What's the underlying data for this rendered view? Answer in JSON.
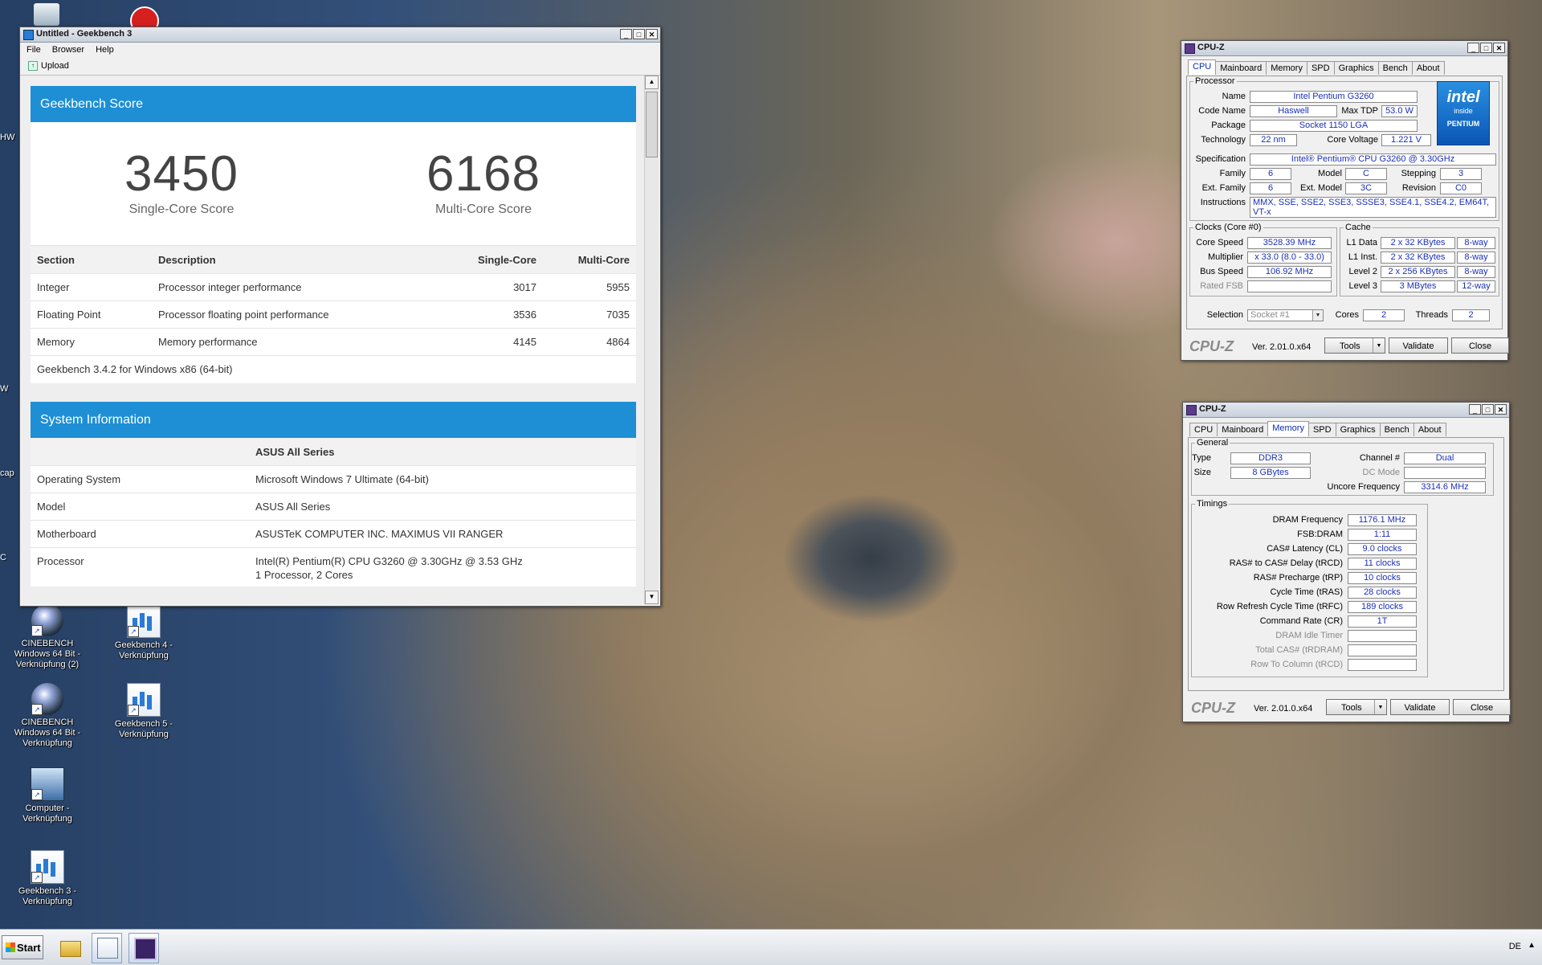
{
  "desktop": {
    "icons": [
      {
        "name": "cinebench-1",
        "label": "CINEBENCH Windows 64 Bit - Verknüpfung (2)",
        "type": "cine"
      },
      {
        "name": "geekbench4",
        "label": "Geekbench 4 - Verknüpfung",
        "type": "gb"
      },
      {
        "name": "cinebench-2",
        "label": "CINEBENCH Windows 64 Bit - Verknüpfung",
        "type": "cine"
      },
      {
        "name": "geekbench5",
        "label": "Geekbench 5 - Verknüpfung",
        "type": "gb"
      },
      {
        "name": "computer",
        "label": "Computer - Verknüpfung",
        "type": "comp"
      },
      {
        "name": "geekbench3",
        "label": "Geekbench 3 - Verknüpfung",
        "type": "gb"
      }
    ],
    "side_labels": [
      "HW",
      "W",
      "cap",
      "C"
    ]
  },
  "geekbench": {
    "title": "Untitled - Geekbench 3",
    "menu": [
      "File",
      "Browser",
      "Help"
    ],
    "toolbar_upload": "Upload",
    "score_header": "Geekbench Score",
    "single_score": "3450",
    "single_label": "Single-Core Score",
    "multi_score": "6168",
    "multi_label": "Multi-Core Score",
    "columns": [
      "Section",
      "Description",
      "Single-Core",
      "Multi-Core"
    ],
    "rows": [
      {
        "section": "Integer",
        "desc": "Processor integer performance",
        "single": "3017",
        "multi": "5955"
      },
      {
        "section": "Floating Point",
        "desc": "Processor floating point performance",
        "single": "3536",
        "multi": "7035"
      },
      {
        "section": "Memory",
        "desc": "Memory performance",
        "single": "4145",
        "multi": "4864"
      }
    ],
    "version": "Geekbench 3.4.2 for Windows x86 (64-bit)",
    "sys_header": "System Information",
    "sys_title": "ASUS All Series",
    "sys_rows": [
      {
        "k": "Operating System",
        "v": "Microsoft Windows 7 Ultimate (64-bit)"
      },
      {
        "k": "Model",
        "v": "ASUS All Series"
      },
      {
        "k": "Motherboard",
        "v": "ASUSTeK COMPUTER INC. MAXIMUS VII RANGER"
      },
      {
        "k": "Processor",
        "v": "Intel(R) Pentium(R) CPU G3260 @ 3.30GHz @ 3.53 GHz",
        "v2": "1 Processor, 2 Cores"
      }
    ]
  },
  "cpuz_cpu": {
    "title": "CPU-Z",
    "tabs": [
      "CPU",
      "Mainboard",
      "Memory",
      "SPD",
      "Graphics",
      "Bench",
      "About"
    ],
    "active_tab": "CPU",
    "processor_legend": "Processor",
    "name_label": "Name",
    "name": "Intel Pentium G3260",
    "codename_label": "Code Name",
    "codename": "Haswell",
    "maxtdp_label": "Max TDP",
    "maxtdp": "53.0 W",
    "package_label": "Package",
    "package": "Socket 1150 LGA",
    "tech_label": "Technology",
    "tech": "22 nm",
    "voltage_label": "Core Voltage",
    "voltage": "1.221 V",
    "spec_label": "Specification",
    "spec": "Intel® Pentium® CPU G3260 @ 3.30GHz",
    "family_label": "Family",
    "family": "6",
    "model_label": "Model",
    "model": "C",
    "stepping_label": "Stepping",
    "stepping": "3",
    "extfamily_label": "Ext. Family",
    "extfamily": "6",
    "extmodel_label": "Ext. Model",
    "extmodel": "3C",
    "revision_label": "Revision",
    "revision": "C0",
    "instr_label": "Instructions",
    "instr": "MMX, SSE, SSE2, SSE3, SSSE3, SSE4.1, SSE4.2, EM64T, VT-x",
    "intel_logo": {
      "w1": "intel",
      "w2": "inside",
      "w3": "PENTIUM"
    },
    "clocks_legend": "Clocks (Core #0)",
    "corespeed_label": "Core Speed",
    "corespeed": "3528.39 MHz",
    "multiplier_label": "Multiplier",
    "multiplier": "x 33.0 (8.0 - 33.0)",
    "busspeed_label": "Bus Speed",
    "busspeed": "106.92 MHz",
    "ratedfsb_label": "Rated FSB",
    "ratedfsb": "",
    "cache_legend": "Cache",
    "cache": [
      {
        "label": "L1 Data",
        "size": "2 x 32 KBytes",
        "way": "8-way"
      },
      {
        "label": "L1 Inst.",
        "size": "2 x 32 KBytes",
        "way": "8-way"
      },
      {
        "label": "Level 2",
        "size": "2 x 256 KBytes",
        "way": "8-way"
      },
      {
        "label": "Level 3",
        "size": "3 MBytes",
        "way": "12-way"
      }
    ],
    "selection_label": "Selection",
    "selection": "Socket #1",
    "cores_label": "Cores",
    "cores": "2",
    "threads_label": "Threads",
    "threads": "2",
    "logo": "CPU-Z",
    "version": "Ver. 2.01.0.x64",
    "tools": "Tools",
    "validate": "Validate",
    "close": "Close"
  },
  "cpuz_mem": {
    "title": "CPU-Z",
    "tabs": [
      "CPU",
      "Mainboard",
      "Memory",
      "SPD",
      "Graphics",
      "Bench",
      "About"
    ],
    "active_tab": "Memory",
    "general_legend": "General",
    "type_label": "Type",
    "type": "DDR3",
    "size_label": "Size",
    "size": "8 GBytes",
    "channel_label": "Channel #",
    "channel": "Dual",
    "dcmode_label": "DC Mode",
    "dcmode": "",
    "uncore_label": "Uncore Frequency",
    "uncore": "3314.6 MHz",
    "timings_legend": "Timings",
    "timings": [
      {
        "label": "DRAM Frequency",
        "value": "1176.1 MHz",
        "dim": false
      },
      {
        "label": "FSB:DRAM",
        "value": "1:11",
        "dim": false
      },
      {
        "label": "CAS# Latency (CL)",
        "value": "9.0 clocks",
        "dim": false
      },
      {
        "label": "RAS# to CAS# Delay (tRCD)",
        "value": "11 clocks",
        "dim": false
      },
      {
        "label": "RAS# Precharge (tRP)",
        "value": "10 clocks",
        "dim": false
      },
      {
        "label": "Cycle Time (tRAS)",
        "value": "28 clocks",
        "dim": false
      },
      {
        "label": "Row Refresh Cycle Time (tRFC)",
        "value": "189 clocks",
        "dim": false
      },
      {
        "label": "Command Rate (CR)",
        "value": "1T",
        "dim": false
      },
      {
        "label": "DRAM Idle Timer",
        "value": "",
        "dim": true
      },
      {
        "label": "Total CAS# (tRDRAM)",
        "value": "",
        "dim": true
      },
      {
        "label": "Row To Column (tRCD)",
        "value": "",
        "dim": true
      }
    ],
    "logo": "CPU-Z",
    "version": "Ver. 2.01.0.x64",
    "tools": "Tools",
    "validate": "Validate",
    "close": "Close"
  },
  "taskbar": {
    "start": "Start",
    "lang": "DE",
    "items": [
      {
        "name": "explorer",
        "active": false
      },
      {
        "name": "geekbench",
        "active": true
      },
      {
        "name": "cpuz",
        "active": true
      }
    ]
  }
}
